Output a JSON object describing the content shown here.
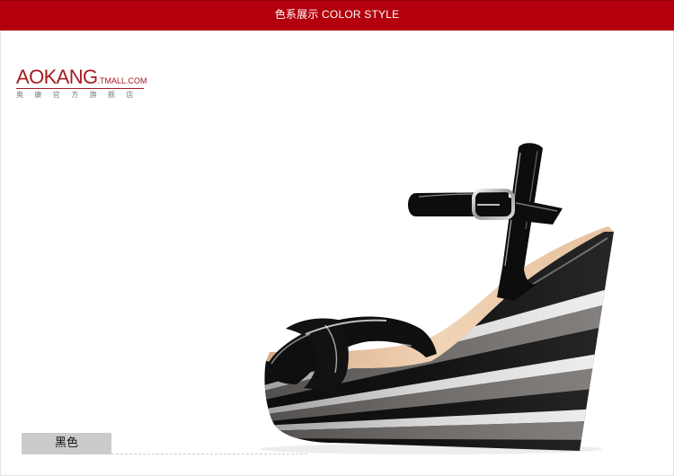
{
  "banner": {
    "title": "色系展示 COLOR STYLE"
  },
  "logo": {
    "brand": "AOKANG",
    "domain": ".TMALL.COM",
    "subtitle": "奥康官方旗舰店"
  },
  "swatch": {
    "label": "黑色"
  },
  "colors": {
    "banner": "#b3000c",
    "brand": "#a51b21",
    "swatch": "#cbcbcb"
  }
}
